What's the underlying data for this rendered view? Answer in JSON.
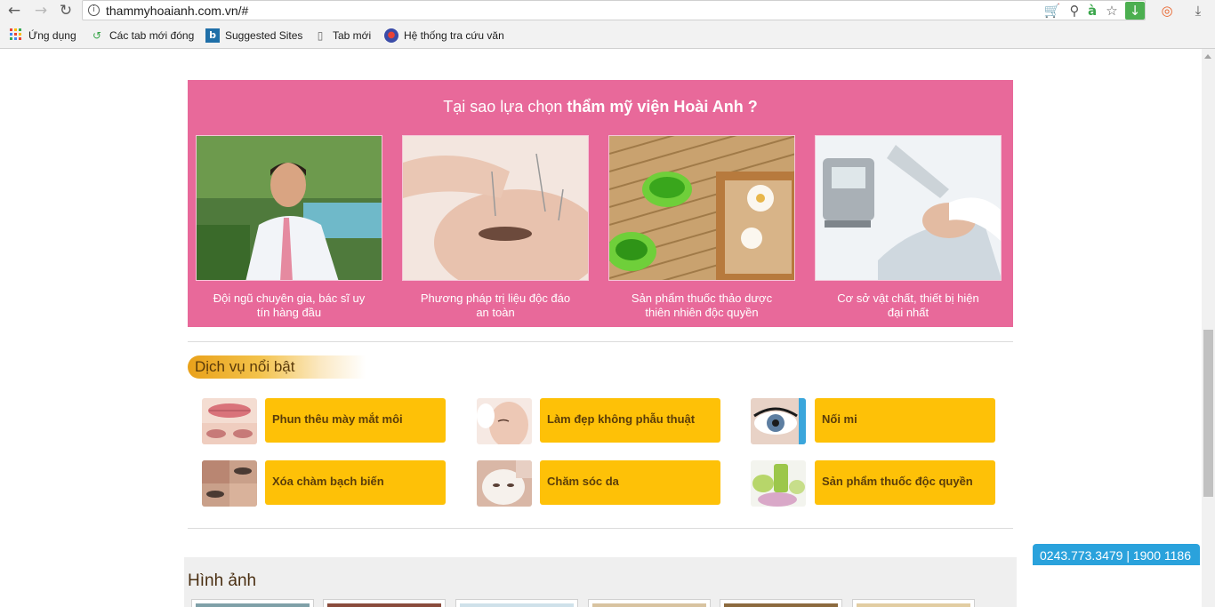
{
  "browser": {
    "url": "thammyhoaianh.com.vn/#",
    "bookmarks": [
      {
        "label": "Ứng dụng",
        "icon": "apps-grid-icon"
      },
      {
        "label": "Các tab mới đóng",
        "icon": "history-icon"
      },
      {
        "label": "Suggested Sites",
        "icon": "bing-icon"
      },
      {
        "label": "Tab mới",
        "icon": "page-icon"
      },
      {
        "label": "Hệ thống tra cứu văn",
        "icon": "seal-icon"
      }
    ]
  },
  "why": {
    "title_prefix": "Tại sao lựa chọn ",
    "title_bold": "thẩm mỹ viện Hoài Anh ?",
    "cards": [
      {
        "line1": "Đội ngũ chuyên gia, bác sĩ uy",
        "line2": "tín hàng đầu",
        "image": "doctor-photo"
      },
      {
        "line1": "Phương pháp trị liệu độc đáo",
        "line2": "an toàn",
        "image": "acupuncture-photo"
      },
      {
        "line1": "Sản phẩm thuốc thảo dược",
        "line2": "thiên nhiên độc quyền",
        "image": "herbal-candles-photo"
      },
      {
        "line1": "Cơ sở vật chất, thiết bị hiện",
        "line2": "đại nhất",
        "image": "laser-device-photo"
      }
    ]
  },
  "services": {
    "heading": "Dịch vụ nổi bật",
    "items": [
      {
        "label": "Phun thêu mày mắt môi",
        "image": "lips-photo"
      },
      {
        "label": "Làm đẹp không phẫu thuật",
        "image": "face-care-photo"
      },
      {
        "label": "Nối mi",
        "image": "eyelash-photo"
      },
      {
        "label": "Xóa chàm bạch biến",
        "image": "skin-photo"
      },
      {
        "label": "Chăm sóc da",
        "image": "facial-mask-photo"
      },
      {
        "label": "Sản phẩm thuốc độc quyền",
        "image": "product-photo"
      }
    ]
  },
  "gallery": {
    "title": "Hình ảnh"
  },
  "hotline": {
    "text": "0243.773.3479 | 1900 1186"
  },
  "colors": {
    "pink": "#e8699a",
    "gold": "#fec107",
    "blue": "#2aa2dc"
  }
}
